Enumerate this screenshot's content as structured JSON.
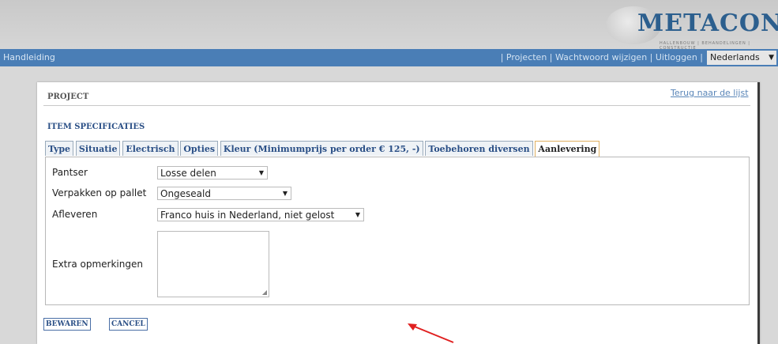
{
  "brand": {
    "name": "METACON",
    "tagline": "HALLENBOUW | BEHANDELINGEN | CONSTRUCTIE"
  },
  "nav": {
    "manual": "Handleiding",
    "links": [
      "| Projecten",
      "| Wachtwoord wijzigen",
      "| Uitloggen |"
    ],
    "language": "Nederlands"
  },
  "page": {
    "title": "PROJECT",
    "back_link": "Terug naar de lijst"
  },
  "section": {
    "title": "ITEM SPECIFICATIES"
  },
  "tabs": [
    {
      "label": "Type"
    },
    {
      "label": "Situatie"
    },
    {
      "label": "Electrisch"
    },
    {
      "label": "Opties"
    },
    {
      "label": "Kleur (Minimumprijs per order € 125, -)"
    },
    {
      "label": "Toebehoren diversen"
    },
    {
      "label": "Aanlevering",
      "active": true
    }
  ],
  "form": {
    "pantser": {
      "label": "Pantser",
      "value": "Losse delen"
    },
    "verpakken": {
      "label": "Verpakken op pallet",
      "value": "Ongeseald"
    },
    "afleveren": {
      "label": "Afleveren",
      "value": "Franco huis in Nederland, niet gelost"
    },
    "opmerkingen": {
      "label": "Extra opmerkingen",
      "value": ""
    }
  },
  "buttons": {
    "save": "BEWAREN",
    "cancel": "CANCEL"
  },
  "colors": {
    "nav_bar": "#4a7eb6",
    "brand": "#2c5f8e",
    "annotation_arrow": "#e02020",
    "active_tab_border": "#e0b060"
  }
}
